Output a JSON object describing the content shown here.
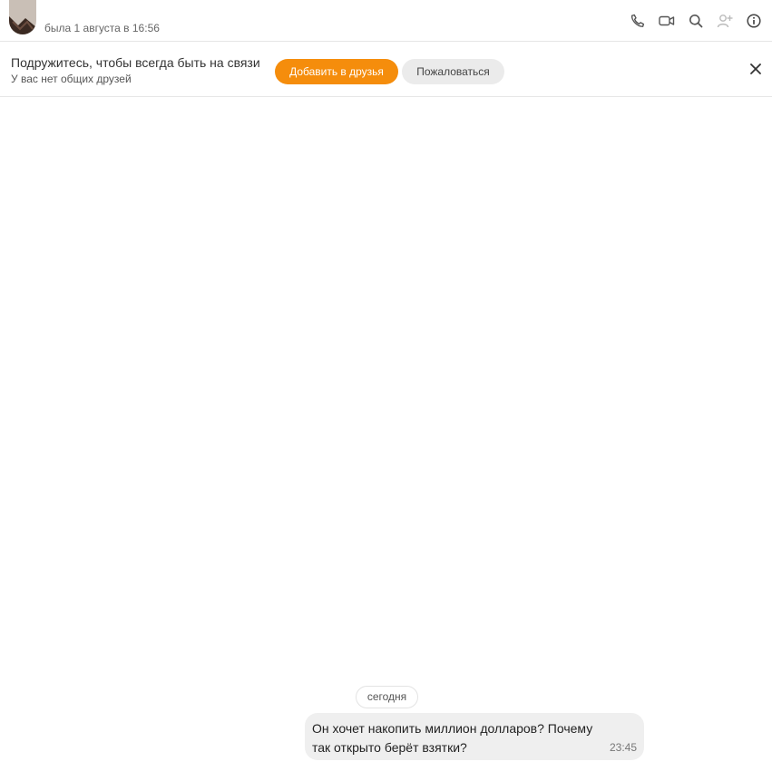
{
  "header": {
    "status": "была 1 августа в 16:56",
    "icons": [
      "phone-icon",
      "video-camera-icon",
      "search-icon",
      "add-user-icon",
      "info-icon"
    ]
  },
  "banner": {
    "title": "Подружитесь, чтобы всегда быть на связи",
    "subtitle": "У вас нет общих друзей",
    "add_label": "Добавить в друзья",
    "report_label": "Пожаловаться"
  },
  "chat": {
    "date_divider": "сегодня",
    "messages": [
      {
        "text": "Он хочет накопить миллион долларов? Почему так открыто берёт взятки?",
        "time": "23:45"
      }
    ]
  },
  "colors": {
    "accent": "#f58d0c",
    "bubble": "#efefef"
  }
}
